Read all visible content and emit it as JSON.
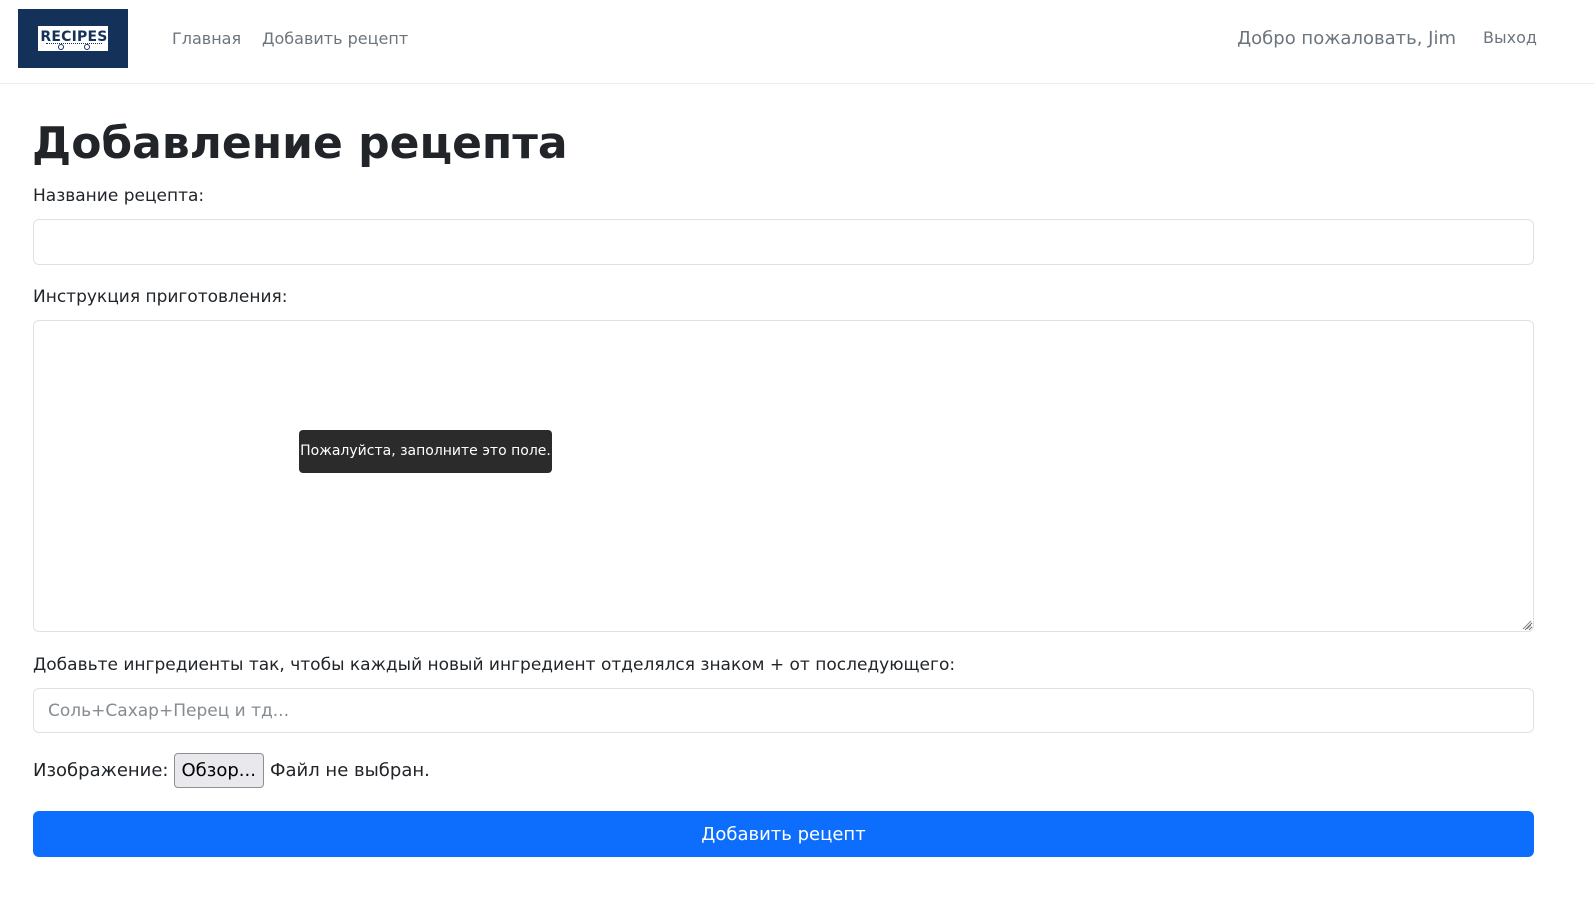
{
  "navbar": {
    "logo_text": "RECIPES",
    "links": [
      {
        "label": "Главная"
      },
      {
        "label": "Добавить рецепт"
      }
    ],
    "welcome": "Добро пожаловать, Jim",
    "logout": "Выход"
  },
  "page": {
    "title": "Добавление рецепта"
  },
  "form": {
    "name_label": "Название рецепта:",
    "name_value": "",
    "instructions_label": "Инструкция приготовления:",
    "instructions_value": "",
    "validation_tooltip": "Пожалуйста, заполните это поле.",
    "ingredients_label": "Добавьте ингредиенты так, чтобы каждый новый ингредиент отделялся знаком + от последующего:",
    "ingredients_placeholder": "Соль+Сахар+Перец и тд...",
    "image_label": "Изображение:",
    "browse_button": "Обзор...",
    "file_status": "Файл не выбран.",
    "submit_button": "Добавить рецепт"
  },
  "colors": {
    "primary": "#0d6efd",
    "logo_bg": "#14315a",
    "muted_text": "#6c757d",
    "tooltip_bg": "#2b2b2b"
  }
}
